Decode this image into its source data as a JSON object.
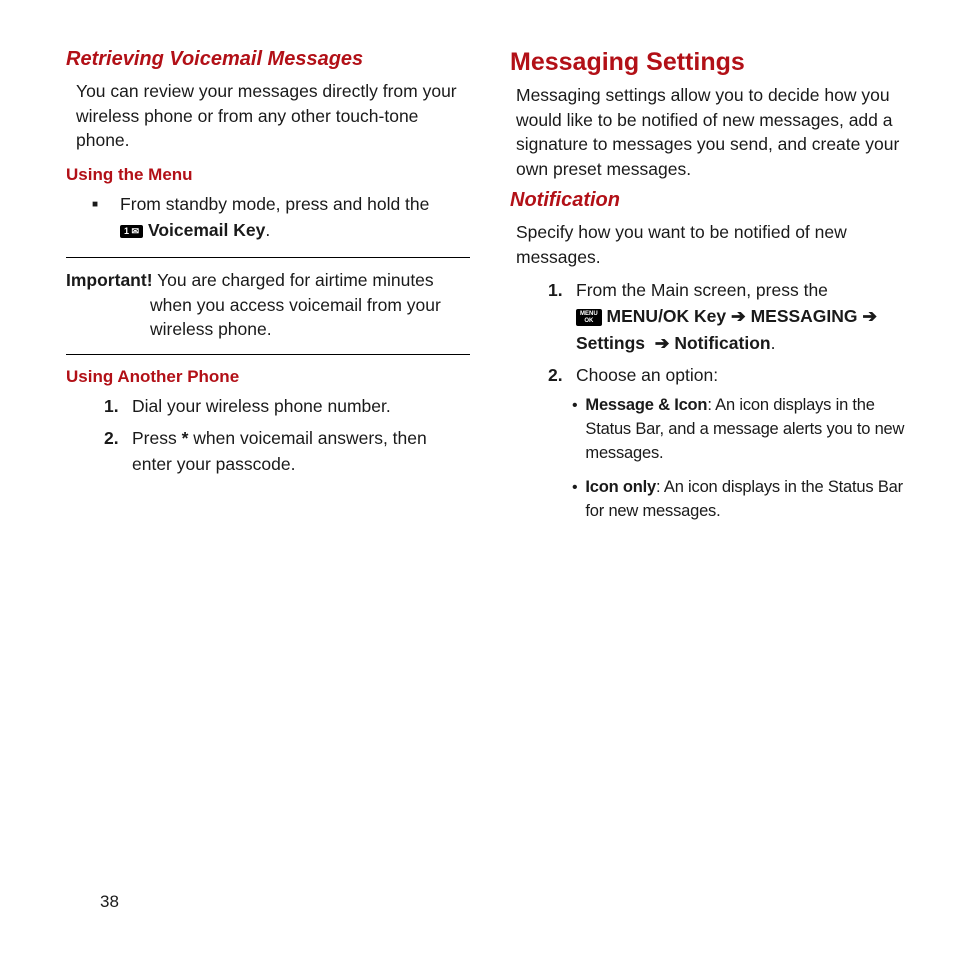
{
  "left": {
    "h1": "Retrieving Voicemail Messages",
    "p1": "You can review your messages directly from your wireless phone or from any other touch-tone phone.",
    "sub1": "Using the Menu",
    "bullet1_a": "From standby mode, press and hold the ",
    "voicemail_icon": "1 ✉",
    "bullet1_b": " Voicemail Key",
    "important_label": "Important!",
    "important_text_a": " You are charged for airtime minutes ",
    "important_text_b": "when you access voicemail from your wireless phone.",
    "sub2": "Using Another Phone",
    "step1": "Dial your wireless phone number.",
    "step2_a": "Press ",
    "step2_star": "*",
    "step2_b": " when voicemail answers, then enter your passcode."
  },
  "right": {
    "h1": "Messaging Settings",
    "p1": "Messaging settings allow you to decide how you would like to be notified of new messages, add a signature to messages you send, and create your own preset messages.",
    "sub1": "Notification",
    "p2": "Specify how you want to be notified of new messages.",
    "step1_a": "From the Main screen, press the ",
    "menu_icon": "MENU OK",
    "step1_b1": " MENU/OK Key",
    "step1_b2": "MESSAGING",
    "step1_b3": "Settings",
    "step1_b4": "Notification",
    "arrow": "➔",
    "step2": "Choose an option:",
    "opt1_label": "Message & Icon",
    "opt1_text": ": An icon displays in the Status Bar, and a message alerts you to new messages.",
    "opt2_label": "Icon only",
    "opt2_text": ": An icon displays in the Status Bar for new messages."
  },
  "page_number": "38"
}
